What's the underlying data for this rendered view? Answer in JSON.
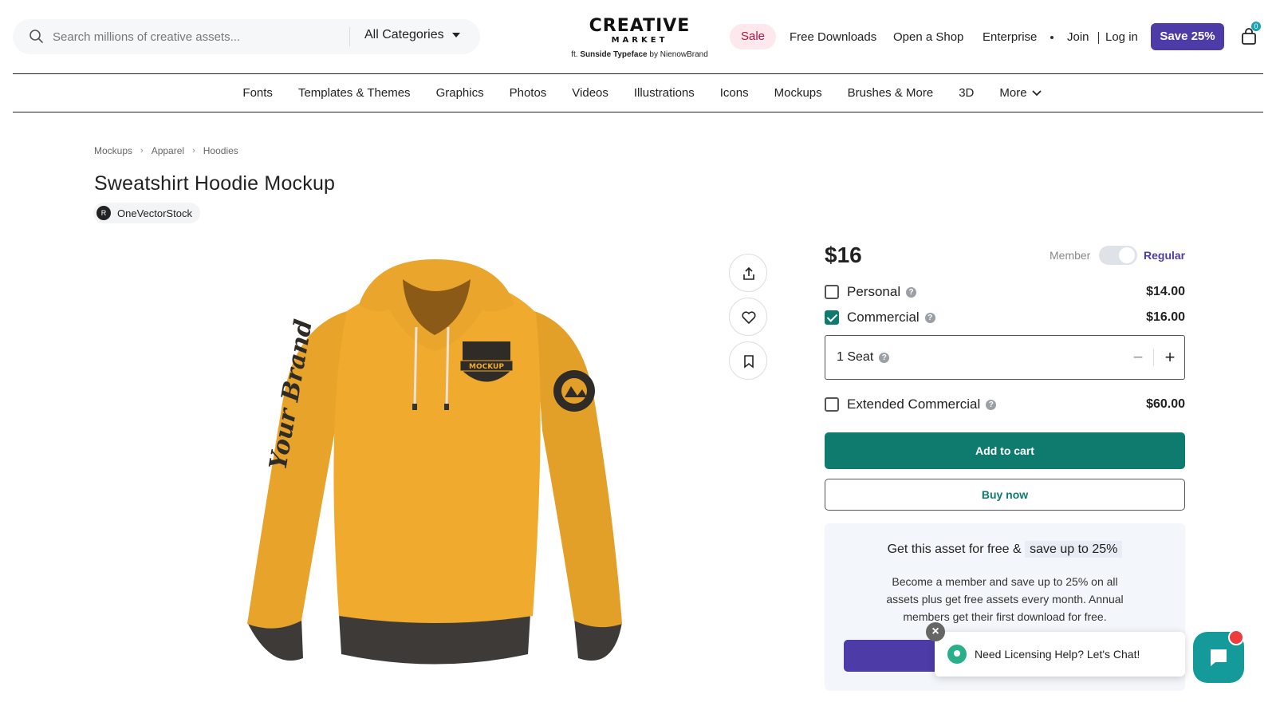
{
  "search": {
    "placeholder": "Search millions of creative assets...",
    "category": "All Categories"
  },
  "logo": {
    "line1": "CREATIVE",
    "line2": "MARKET",
    "credit_prefix": "ft.",
    "credit_font": "Sunside Typeface",
    "credit_by": "by NienowBrand"
  },
  "topnav": {
    "sale": "Sale",
    "free_downloads": "Free Downloads",
    "open_shop": "Open a Shop",
    "enterprise": "Enterprise",
    "join": "Join",
    "login": "Log in",
    "save": "Save 25%",
    "cart_count": "0"
  },
  "categories": [
    "Fonts",
    "Templates & Themes",
    "Graphics",
    "Photos",
    "Videos",
    "Illustrations",
    "Icons",
    "Mockups",
    "Brushes & More",
    "3D",
    "More"
  ],
  "breadcrumb": [
    "Mockups",
    "Apparel",
    "Hoodies"
  ],
  "product": {
    "title": "Sweatshirt Hoodie Mockup",
    "author": "OneVectorStock",
    "author_initial": "R",
    "mockup_badge": "MOCKUP",
    "sleeve_text": "Your Brand"
  },
  "pricing": {
    "price": "$16",
    "member_label": "Member",
    "regular_label": "Regular",
    "licenses": [
      {
        "name": "Personal",
        "price": "$14.00",
        "checked": false
      },
      {
        "name": "Commercial",
        "price": "$16.00",
        "checked": true
      },
      {
        "name": "Extended Commercial",
        "price": "$60.00",
        "checked": false
      }
    ],
    "seat_label": "1 Seat",
    "add_to_cart": "Add to cart",
    "buy_now": "Buy now"
  },
  "promo": {
    "heading": "Get this asset for free &",
    "highlight": "save up to 25%",
    "body": "Become a member and save up to 25% on all assets plus get free assets every month. Annual members get their first download for free."
  },
  "chat": {
    "message": "Need Licensing Help? Let's Chat!"
  },
  "colors": {
    "brand_purple": "#4d3ca8",
    "teal": "#0f7a6e",
    "hoodie_yellow": "#f0ab2e",
    "sale_pink": "#fde8ee"
  }
}
